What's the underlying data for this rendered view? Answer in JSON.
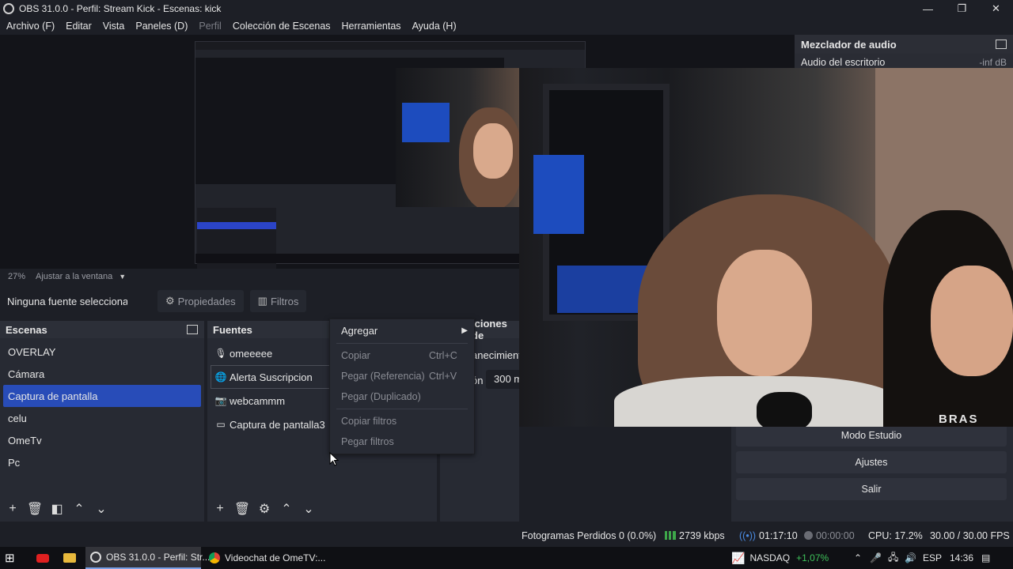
{
  "window": {
    "title": "OBS 31.0.0 - Perfil: Stream Kick - Escenas: kick",
    "minimize": "—",
    "restore": "❐",
    "close": "✕"
  },
  "menu": {
    "items": [
      {
        "label": "Archivo (F)",
        "disabled": false
      },
      {
        "label": "Editar",
        "disabled": false
      },
      {
        "label": "Vista",
        "disabled": false
      },
      {
        "label": "Paneles (D)",
        "disabled": false
      },
      {
        "label": "Perfil",
        "disabled": true
      },
      {
        "label": "Colección de Escenas",
        "disabled": false
      },
      {
        "label": "Herramientas",
        "disabled": false
      },
      {
        "label": "Ayuda (H)",
        "disabled": false
      }
    ]
  },
  "mixer": {
    "title": "Mezclador de audio",
    "source": "Audio del escritorio",
    "level": "-inf dB"
  },
  "zoom": {
    "percent": "27%",
    "mode": "Ajustar a la ventana"
  },
  "source_toolbar": {
    "no_selection": "Ninguna fuente seleccionada",
    "properties": "Propiedades",
    "filters": "Filtros"
  },
  "scenes": {
    "title": "Escenas",
    "items": [
      "OVERLAY",
      "Cámara",
      "Captura de pantalla",
      "celu",
      "OmeTv",
      "Pc"
    ],
    "selected_index": 2
  },
  "sources": {
    "title": "Fuentes",
    "items": [
      {
        "label": "omeeeee",
        "icon": "microphone-icon"
      },
      {
        "label": "Alerta Suscripcion",
        "icon": "browser-icon"
      },
      {
        "label": "webcammm",
        "icon": "camera-icon"
      },
      {
        "label": "Captura de pantalla3",
        "icon": "monitor-icon"
      }
    ]
  },
  "context_menu": {
    "add": "Agregar",
    "copy": "Copiar",
    "copy_shortcut": "Ctrl+C",
    "paste_ref": "Pegar (Referencia)",
    "paste_ref_shortcut": "Ctrl+V",
    "paste_dup": "Pegar (Duplicado)",
    "copy_filters": "Copiar filtros",
    "paste_filters": "Pegar filtros"
  },
  "transitions": {
    "title_partial": "iciones de",
    "text1_partial": "anecimient",
    "duration_label_partial": "ón",
    "duration_partial": "300 m"
  },
  "controls": {
    "studio_mode": "Modo Estudio",
    "settings": "Ajustes",
    "exit": "Salir"
  },
  "webcam": {
    "shirt_text": "BRAS"
  },
  "status": {
    "dropped_frames": "Fotogramas Perdidos 0 (0.0%)",
    "bitrate": "2739 kbps",
    "stream_time": "01:17:10",
    "record_time": "00:00:00",
    "cpu": "CPU: 17.2%",
    "fps": "30.00 / 30.00 FPS"
  },
  "taskbar": {
    "obs_task": "OBS 31.0.0 - Perfil: Str...",
    "chrome_task": "Videochat de OmeTV:...",
    "ticker": "NASDAQ",
    "ticker_change": "+1,07%",
    "language": "ESP",
    "clock": "14:36"
  },
  "colors": {
    "accent": "#284cb8",
    "background": "#1d1f26",
    "panel": "#272a33",
    "positive": "#3ec25a"
  }
}
